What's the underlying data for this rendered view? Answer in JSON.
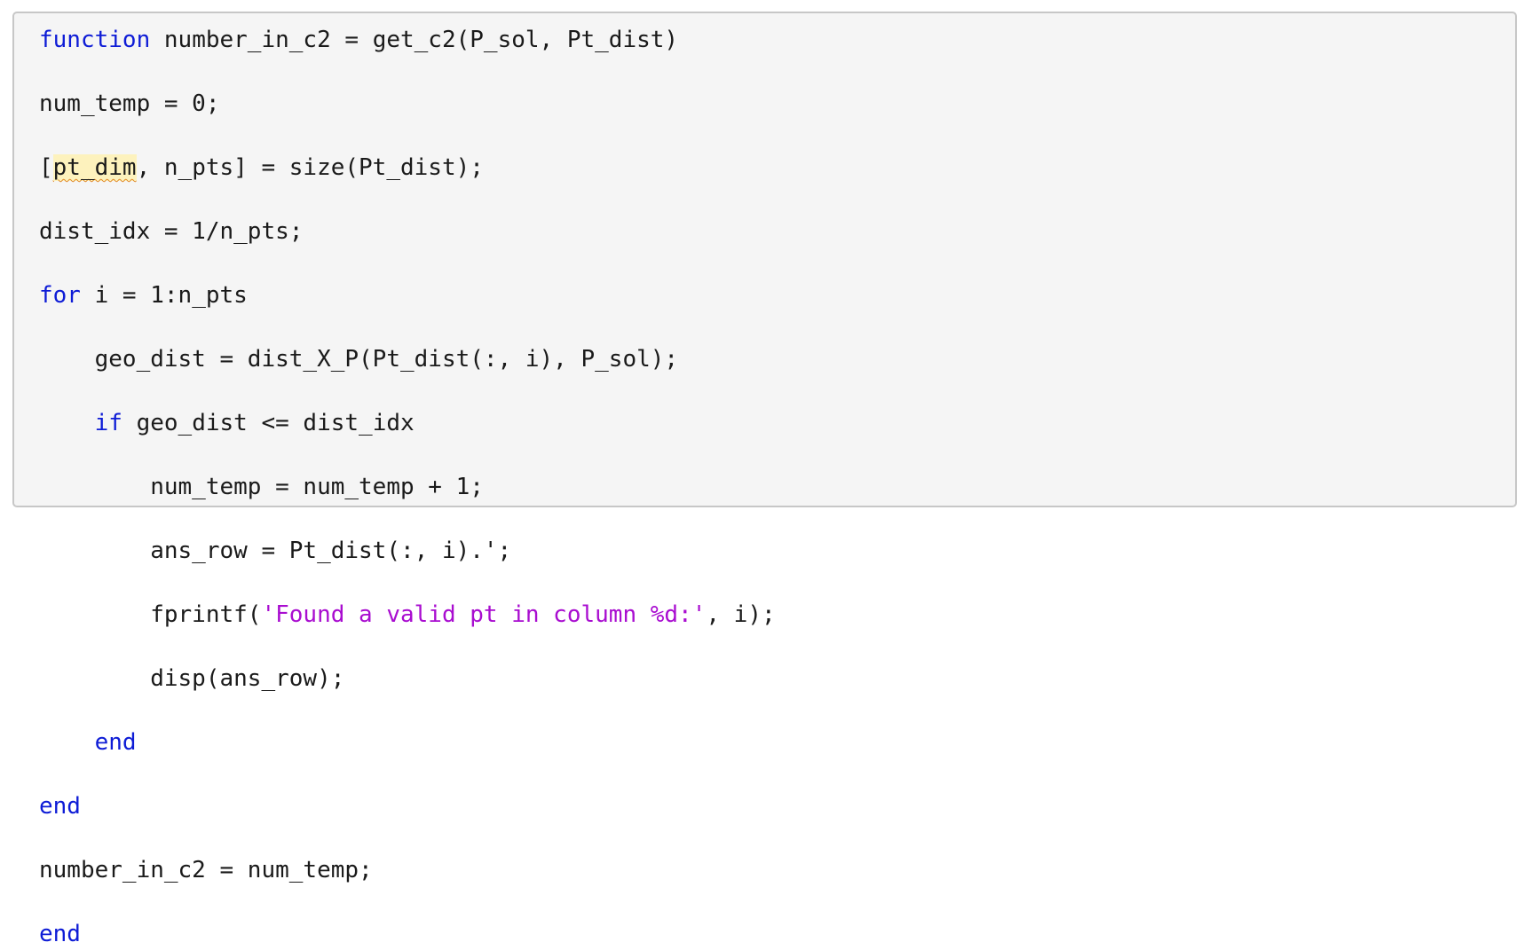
{
  "code_lines": [
    [
      {
        "text": "function",
        "type": "keyword"
      },
      {
        "text": " number_in_c2 = get_c2(P_sol, Pt_dist)",
        "type": "plain"
      }
    ],
    [
      {
        "text": "num_temp = 0;",
        "type": "plain"
      }
    ],
    [
      {
        "text": "[",
        "type": "plain"
      },
      {
        "text": "pt_dim",
        "type": "warning"
      },
      {
        "text": ", n_pts] = size(Pt_dist);",
        "type": "plain"
      }
    ],
    [
      {
        "text": "dist_idx = 1/n_pts;",
        "type": "plain"
      }
    ],
    [
      {
        "text": "for",
        "type": "keyword"
      },
      {
        "text": " i = 1:n_pts",
        "type": "plain"
      }
    ],
    [
      {
        "text": "    geo_dist = dist_X_P(Pt_dist(:, i), P_sol);",
        "type": "plain"
      }
    ],
    [
      {
        "text": "    ",
        "type": "plain"
      },
      {
        "text": "if",
        "type": "keyword"
      },
      {
        "text": " geo_dist <= dist_idx",
        "type": "plain"
      }
    ],
    [
      {
        "text": "        num_temp = num_temp + 1;",
        "type": "plain"
      }
    ],
    [
      {
        "text": "        ans_row = Pt_dist(:, i).';",
        "type": "plain"
      }
    ],
    [
      {
        "text": "        fprintf(",
        "type": "plain"
      },
      {
        "text": "'Found a valid pt in column %d:'",
        "type": "string"
      },
      {
        "text": ", i);",
        "type": "plain"
      }
    ],
    [
      {
        "text": "        disp(ans_row);",
        "type": "plain"
      }
    ],
    [
      {
        "text": "    ",
        "type": "plain"
      },
      {
        "text": "end",
        "type": "keyword"
      }
    ],
    [
      {
        "text": "end",
        "type": "keyword"
      }
    ],
    [
      {
        "text": "number_in_c2 = num_temp;",
        "type": "plain"
      }
    ],
    [
      {
        "text": "end",
        "type": "keyword"
      }
    ]
  ],
  "colors": {
    "keyword": "#0e1cd6",
    "string": "#a90dd0",
    "plain": "#1a1a1a",
    "warning_highlight": "#fdf2bd",
    "warning_underline": "#e0892a",
    "editor_background": "#f5f5f5",
    "editor_border": "#c7c7c7"
  }
}
